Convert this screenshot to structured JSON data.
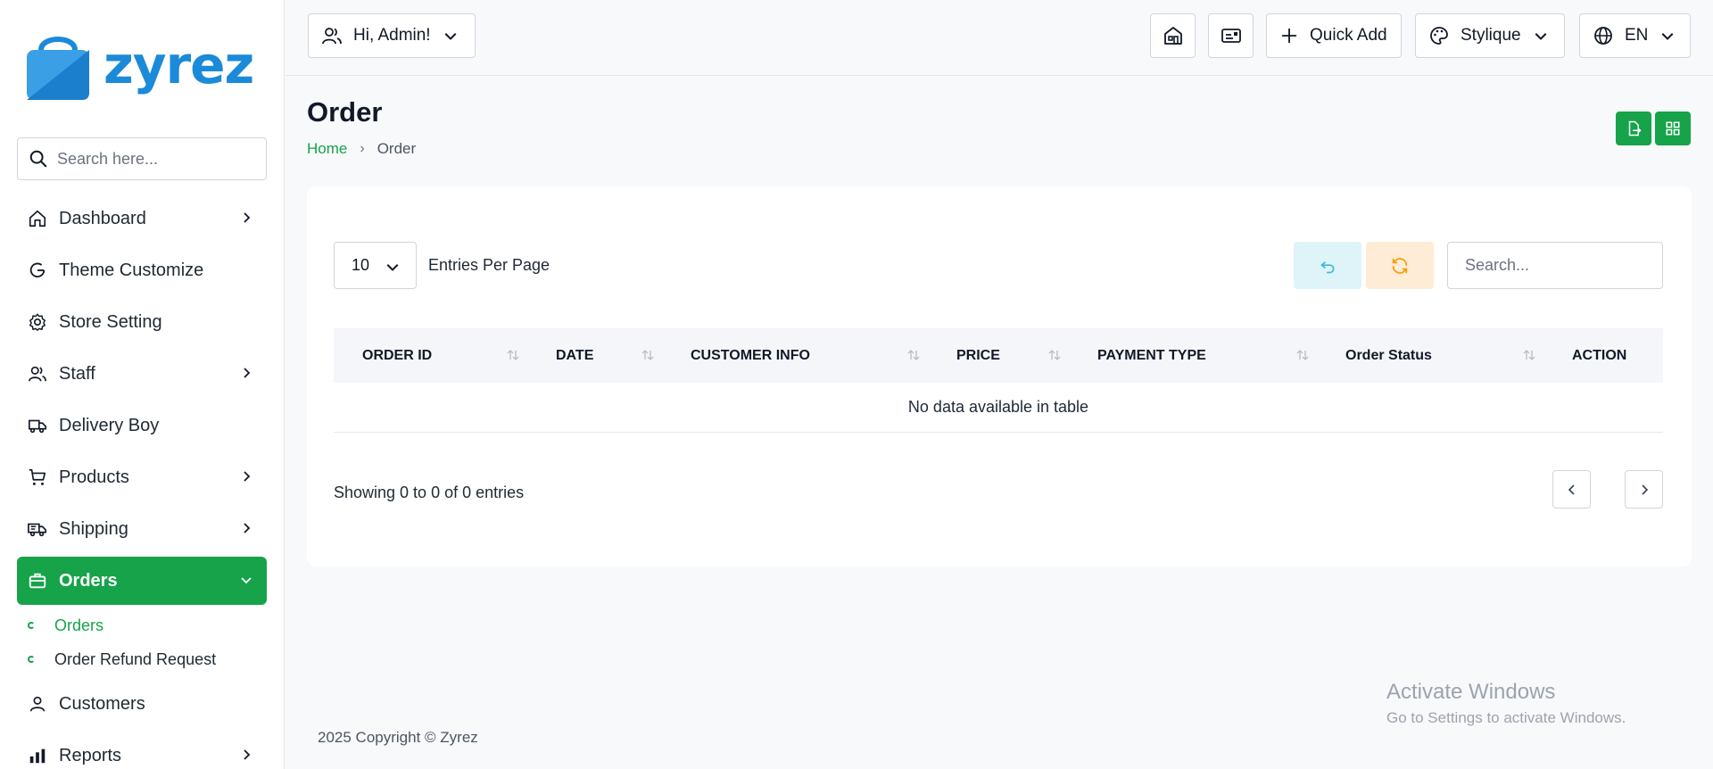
{
  "brand": {
    "name": "zyrez",
    "color": "#1b8ad8"
  },
  "sidebar": {
    "search_placeholder": "Search here...",
    "items": [
      {
        "label": "Dashboard",
        "icon": "home-icon",
        "has_children": true
      },
      {
        "label": "Theme Customize",
        "icon": "palette-refresh-icon",
        "has_children": false
      },
      {
        "label": "Store Setting",
        "icon": "gear-icon",
        "has_children": false
      },
      {
        "label": "Staff",
        "icon": "users-icon",
        "has_children": true
      },
      {
        "label": "Delivery Boy",
        "icon": "truck-icon",
        "has_children": false
      },
      {
        "label": "Products",
        "icon": "cart-icon",
        "has_children": true
      },
      {
        "label": "Shipping",
        "icon": "shipping-truck-icon",
        "has_children": true
      },
      {
        "label": "Orders",
        "icon": "briefcase-icon",
        "has_children": true,
        "active": true
      },
      {
        "label": "Customers",
        "icon": "user-icon",
        "has_children": false
      },
      {
        "label": "Reports",
        "icon": "chart-icon",
        "has_children": true
      }
    ],
    "orders_sub": [
      {
        "label": "Orders",
        "current": true
      },
      {
        "label": "Order Refund Request",
        "current": false
      }
    ]
  },
  "header": {
    "user_greeting": "Hi, Admin!",
    "quick_add": "Quick Add",
    "theme": "Stylique",
    "language": "EN"
  },
  "page": {
    "title": "Order",
    "breadcrumb_home": "Home",
    "breadcrumb_current": "Order"
  },
  "table": {
    "entries_value": "10",
    "entries_label": "Entries Per Page",
    "search_placeholder": "Search...",
    "columns": [
      "ORDER ID",
      "DATE",
      "CUSTOMER INFO",
      "PRICE",
      "PAYMENT TYPE",
      "Order Status",
      "ACTION"
    ],
    "empty_message": "No data available in table",
    "showing": "Showing 0 to 0 of 0 entries"
  },
  "footer": {
    "copyright": "2025 Copyright © Zyrez"
  },
  "watermark": {
    "title": "Activate Windows",
    "subtitle": "Go to Settings to activate Windows."
  },
  "colors": {
    "accent": "#16a34a",
    "reset_btn": "#dff4f8",
    "refresh_btn": "#ffecd6"
  }
}
